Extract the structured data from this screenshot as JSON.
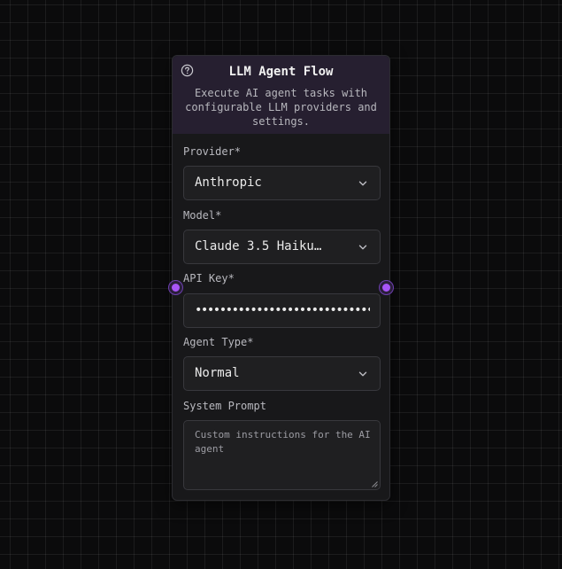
{
  "node": {
    "title": "LLM Agent Flow",
    "description": "Execute AI agent tasks with configurable LLM providers and settings.",
    "help_icon": "question-circle-icon",
    "accent_color": "#a855f7",
    "header_color": "#261f30"
  },
  "fields": {
    "provider": {
      "label": "Provider*",
      "value": "Anthropic"
    },
    "model": {
      "label": "Model*",
      "value": "Claude 3.5 Haiku…"
    },
    "api_key": {
      "label": "API Key*",
      "value": "••••••••••••••••••••••••••••••••••••"
    },
    "agent_type": {
      "label": "Agent Type*",
      "value": "Normal"
    },
    "system_prompt": {
      "label": "System Prompt",
      "placeholder": "Custom instructions for the AI agent"
    }
  },
  "icons": {
    "dropdown": "chevron-down-icon",
    "resize": "resize-grip-icon"
  }
}
